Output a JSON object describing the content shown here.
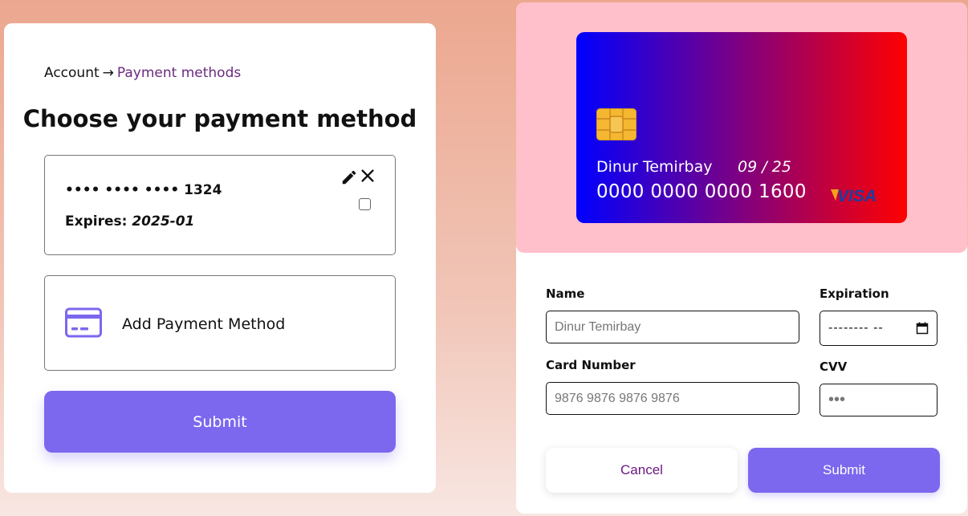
{
  "breadcrumb": {
    "parent": "Account",
    "separator": "→",
    "current": "Payment methods"
  },
  "page_title": "Choose your payment method",
  "saved_card": {
    "number": "•••• •••• •••• 1324",
    "expires_label": "Expires:",
    "expires_value": "2025-01",
    "icons": [
      "pencil-icon",
      "close-icon"
    ],
    "selected": false
  },
  "add_method": {
    "label": "Add Payment Method",
    "icon": "credit-card-icon"
  },
  "left_submit_label": "Submit",
  "card_preview": {
    "holder": "Dinur Temirbay",
    "expiry": "09 / 25",
    "number": "0000 0000 0000 1600",
    "brand": "VISA",
    "gradient": [
      "#0000ff",
      "#ff0000"
    ]
  },
  "form": {
    "name_label": "Name",
    "name_placeholder": "Dinur Temirbay",
    "expiration_label": "Expiration",
    "expiration_value": "--------  --",
    "card_number_label": "Card Number",
    "card_number_placeholder": "9876 9876 9876 9876",
    "cvv_label": "CVV",
    "cvv_value": "•••"
  },
  "cancel_label": "Cancel",
  "right_submit_label": "Submit",
  "colors": {
    "accent": "#7b68ee",
    "breadcrumb_current": "#6b2a80",
    "preview_bg": "#ffc0cb"
  }
}
